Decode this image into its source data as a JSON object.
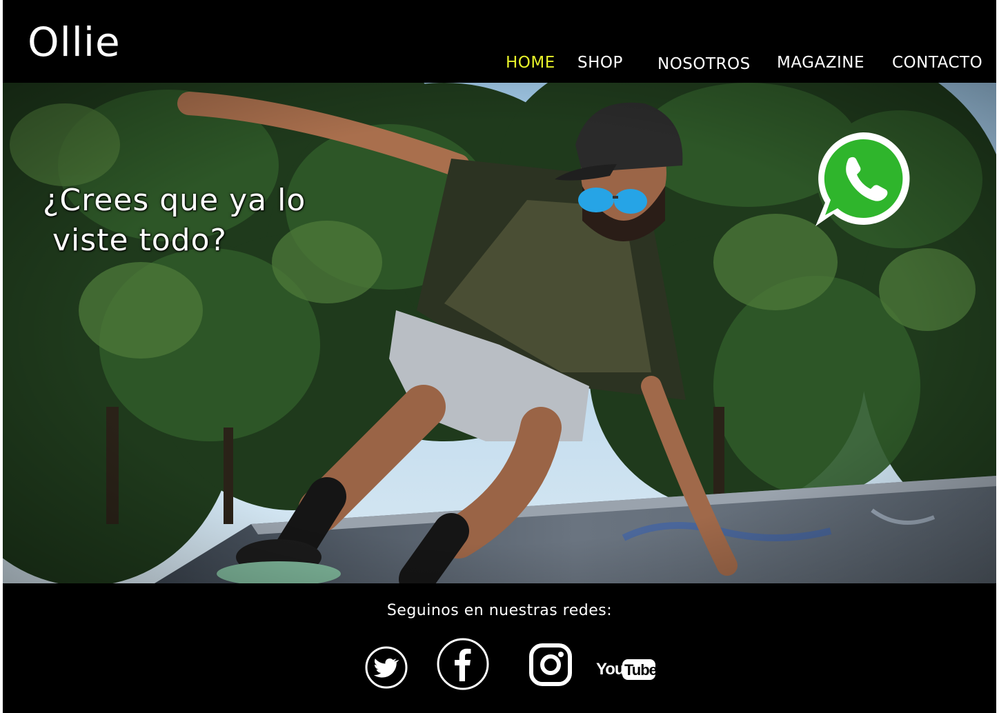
{
  "header": {
    "logo": "Ollie",
    "nav": [
      {
        "label": "HOME",
        "active": true
      },
      {
        "label": "SHOP",
        "active": false
      },
      {
        "label": "NOSOTROS",
        "active": false
      },
      {
        "label": "MAGAZINE",
        "active": false
      },
      {
        "label": "CONTACTO",
        "active": false
      }
    ]
  },
  "hero": {
    "headline_line1": "¿Crees que ya lo",
    "headline_line2": "viste todo?",
    "whatsapp_icon": "whatsapp-icon"
  },
  "footer": {
    "follow_text": "Seguinos en nuestras redes:",
    "social": [
      {
        "name": "twitter-icon"
      },
      {
        "name": "facebook-icon"
      },
      {
        "name": "instagram-icon"
      },
      {
        "name": "youtube-icon",
        "label_you": "You",
        "label_tube": "Tube"
      }
    ]
  },
  "colors": {
    "background": "#000000",
    "nav_active": "#e8f32a",
    "text": "#ffffff",
    "whatsapp_green": "#2fb52c"
  }
}
